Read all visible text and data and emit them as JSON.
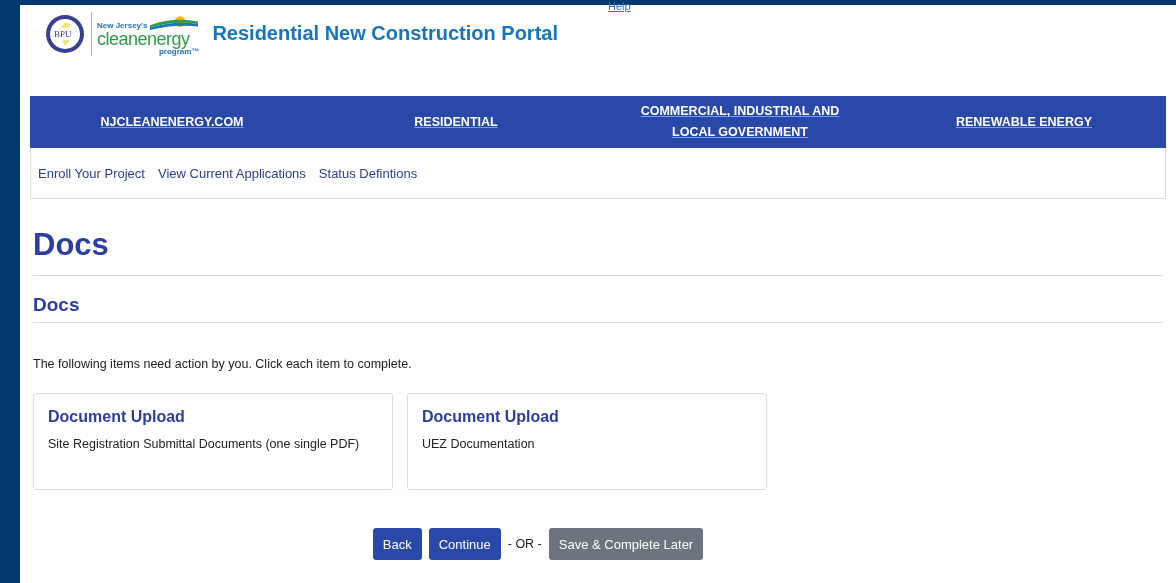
{
  "header": {
    "help_link": "Help",
    "logo": {
      "small_text": "New Jersey's",
      "brand": "cleanenergy",
      "sub": "program™",
      "seal": "BPU"
    },
    "title": "Residential New Construction Portal"
  },
  "main_nav": [
    {
      "label": "NJCLEANENERGY.COM"
    },
    {
      "label": "RESIDENTIAL"
    },
    {
      "label": "COMMERCIAL, INDUSTRIAL AND LOCAL GOVERNMENT"
    },
    {
      "label": "RENEWABLE ENERGY"
    }
  ],
  "sub_nav": [
    "Enroll Your Project",
    "View Current Applications",
    "Status Defintions"
  ],
  "page_title": "Docs",
  "section_title": "Docs",
  "instructions": "The following items need action by you. Click each item to complete.",
  "cards": [
    {
      "title": "Document Upload",
      "description": "Site Registration Submittal Documents (one single PDF)"
    },
    {
      "title": "Document Upload",
      "description": "UEZ Documentation"
    }
  ],
  "actions": [
    {
      "kind": "primary",
      "label": "Back"
    },
    {
      "kind": "primary",
      "label": "Continue"
    },
    {
      "kind": "separator",
      "label": "- OR -"
    },
    {
      "kind": "secondary",
      "label": "Save & Complete Later"
    }
  ]
}
